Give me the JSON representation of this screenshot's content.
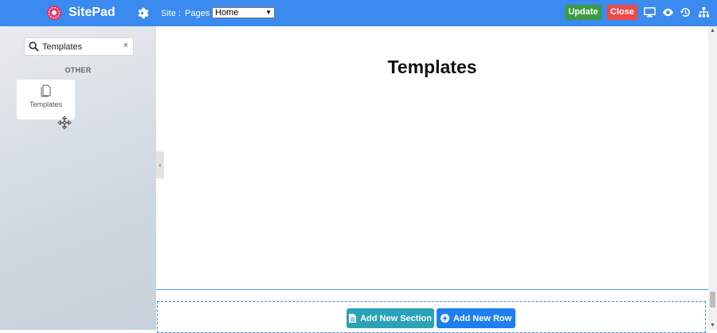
{
  "brand": {
    "name": "SitePad"
  },
  "topbar": {
    "site_label": "Site :",
    "pages_label": "Pages :",
    "pages_selected": "Home",
    "update_label": "Update",
    "close_label": "Close",
    "icons": [
      "desktop-icon",
      "eye-icon",
      "history-icon",
      "sitemap-icon"
    ]
  },
  "sidebar": {
    "search_value": "Templates",
    "clear_symbol": "×",
    "section_heading": "OTHER",
    "widgets": [
      {
        "label": "Templates",
        "icon": "file-icon"
      }
    ]
  },
  "canvas": {
    "heading": "Templates",
    "add_section_label": "Add New Section",
    "add_row_label": "Add New Row"
  },
  "colors": {
    "topbar": "#3a8af0",
    "update": "#3c9b45",
    "close": "#ef4a4a",
    "add_section": "#2aa3b8",
    "add_row": "#1e7ff0"
  }
}
